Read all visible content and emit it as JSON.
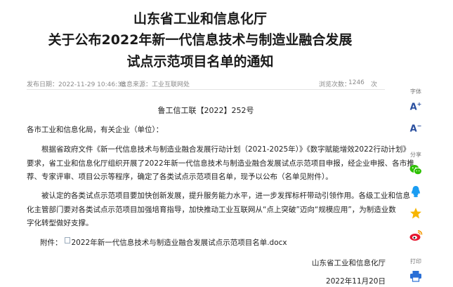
{
  "title": {
    "line1": "山东省工业和信息化厅",
    "line2": "关于公布2022年新一代信息技术与制造业融合发展",
    "line3": "试点示范项目名单的通知"
  },
  "meta": {
    "publish_date": "发布日期：2022-11-29 10:46:38",
    "source": "信息来源：工业互联网处",
    "views_label": "浏览次数：",
    "views_count": "1246",
    "views_unit": "次"
  },
  "doc_number": "鲁工信工联【2022】252号",
  "salutation": "各市工业和信息化局，有关企业（单位）：",
  "paragraph1": {
    "line1": "根据省政府文件《新一代信息技术与制造业融合发展行动计划（2021-2025年）》《数字赋能增效2022行动计划》",
    "line2": "要求，省工业和信息化厅组织开展了2022年新一代信息技术与制造业融合发展试点示范项目申报，经企业申报、各市推",
    "line3": "荐、专家评审、项目公示等程序，确定了各类试点示范项目名单，现予以公布（名单见附件）。"
  },
  "paragraph2": {
    "line1": "被认定的各类试点示范项目要加快创新发展，提升服务能力水平，进一步发挥标杆带动引领作用。各级工业和信息",
    "line2": "化主管部门要对各类试点示范项目加强培育指导，加快推动工业互联网从“点上突破”迈向“规模应用”，为制造业数",
    "line3": "字化转型做好支撑。"
  },
  "attachment": {
    "label": "附件：",
    "filename": "2022年新一代信息技术与制造业融合发展试点示范项目名单.docx"
  },
  "signature": {
    "org": "山东省工业和信息化厅",
    "date": "2022年11月20日"
  },
  "toolbar": {
    "font_label": "字体",
    "font_increase": "A",
    "font_decrease": "A",
    "share_label": "分享",
    "print_label": "打印",
    "colors": {
      "wechat": "#2dc100",
      "qq": "#1b9df2",
      "qzone": "#f7b500",
      "weibo": "#e6162d",
      "print": "#2a6fd6",
      "font": "#2a4f9f"
    },
    "icons": [
      "wechat-icon",
      "qq-icon",
      "qzone-star-icon",
      "weibo-icon",
      "printer-icon"
    ]
  }
}
